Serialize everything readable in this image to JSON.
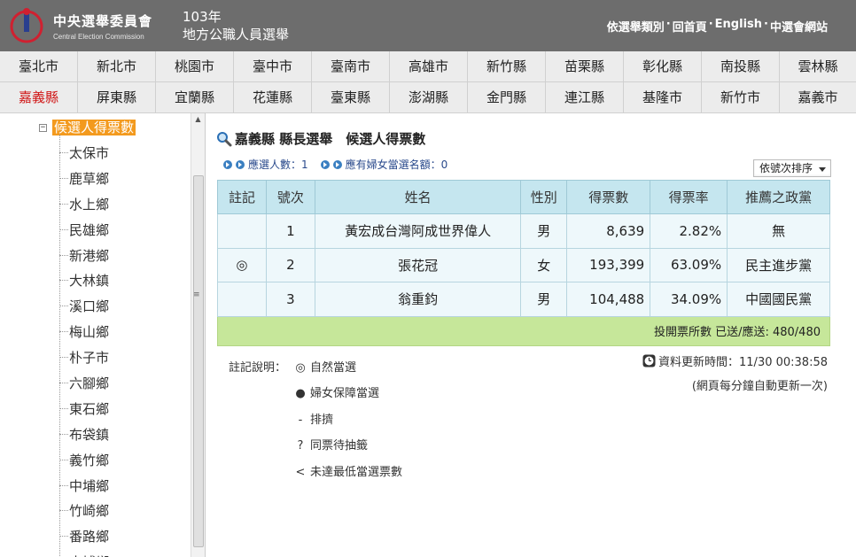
{
  "header": {
    "logo_zh": "中央選舉委員會",
    "logo_en": "Central Election Commission",
    "election_year": "103年",
    "election_name": "地方公職人員選舉",
    "links": [
      "依選舉類別",
      "回首頁",
      "English",
      "中選會網站"
    ],
    "link_separator": "·"
  },
  "counties": {
    "row1": [
      "臺北市",
      "新北市",
      "桃園市",
      "臺中市",
      "臺南市",
      "高雄市",
      "新竹縣",
      "苗栗縣",
      "彰化縣",
      "南投縣",
      "雲林縣"
    ],
    "row2": [
      "嘉義縣",
      "屏東縣",
      "宜蘭縣",
      "花蓮縣",
      "臺東縣",
      "澎湖縣",
      "金門縣",
      "連江縣",
      "基隆市",
      "新竹市",
      "嘉義市"
    ],
    "active": "嘉義縣",
    "active_color": "#d01818"
  },
  "sidebar": {
    "root_label": "候選人得票數",
    "toggle_symbol": "−",
    "items": [
      "太保市",
      "鹿草鄉",
      "水上鄉",
      "民雄鄉",
      "新港鄉",
      "大林鎮",
      "溪口鄉",
      "梅山鄉",
      "朴子市",
      "六腳鄉",
      "東石鄉",
      "布袋鎮",
      "義竹鄉",
      "中埔鄉",
      "竹崎鄉",
      "番路鄉",
      "大埔鄉"
    ]
  },
  "main": {
    "title": "嘉義縣 縣長選舉　候選人得票數",
    "elected_count_label": "應選人數：1",
    "women_quota_label": "應有婦女當選名額：0",
    "sort_label": "依號次排序",
    "table": {
      "headers": [
        "註記",
        "號次",
        "姓名",
        "性別",
        "得票數",
        "得票率",
        "推薦之政黨"
      ],
      "rows": [
        {
          "mark": "",
          "no": "1",
          "name": "黃宏成台灣阿成世界偉人",
          "gender": "男",
          "votes": "8,639",
          "rate": "2.82%",
          "party": "無"
        },
        {
          "mark": "◎",
          "no": "2",
          "name": "張花冠",
          "gender": "女",
          "votes": "193,399",
          "rate": "63.09%",
          "party": "民主進步黨"
        },
        {
          "mark": "",
          "no": "3",
          "name": "翁重鈞",
          "gender": "男",
          "votes": "104,488",
          "rate": "34.09%",
          "party": "中國國民黨"
        }
      ],
      "footer": "投開票所數 已送/應送: 480/480"
    },
    "legend": {
      "title": "註記說明：",
      "items": [
        {
          "symbol": "◎",
          "text": "自然當選"
        },
        {
          "symbol": "●",
          "text": "婦女保障當選"
        },
        {
          "symbol": "-",
          "text": "排擠"
        },
        {
          "symbol": "?",
          "text": "同票待抽籤"
        },
        {
          "symbol": "<",
          "text": "未達最低當選票數"
        }
      ]
    },
    "update_time": "資料更新時間：11/30 00:38:58",
    "update_note": "(網頁每分鐘自動更新一次)"
  }
}
